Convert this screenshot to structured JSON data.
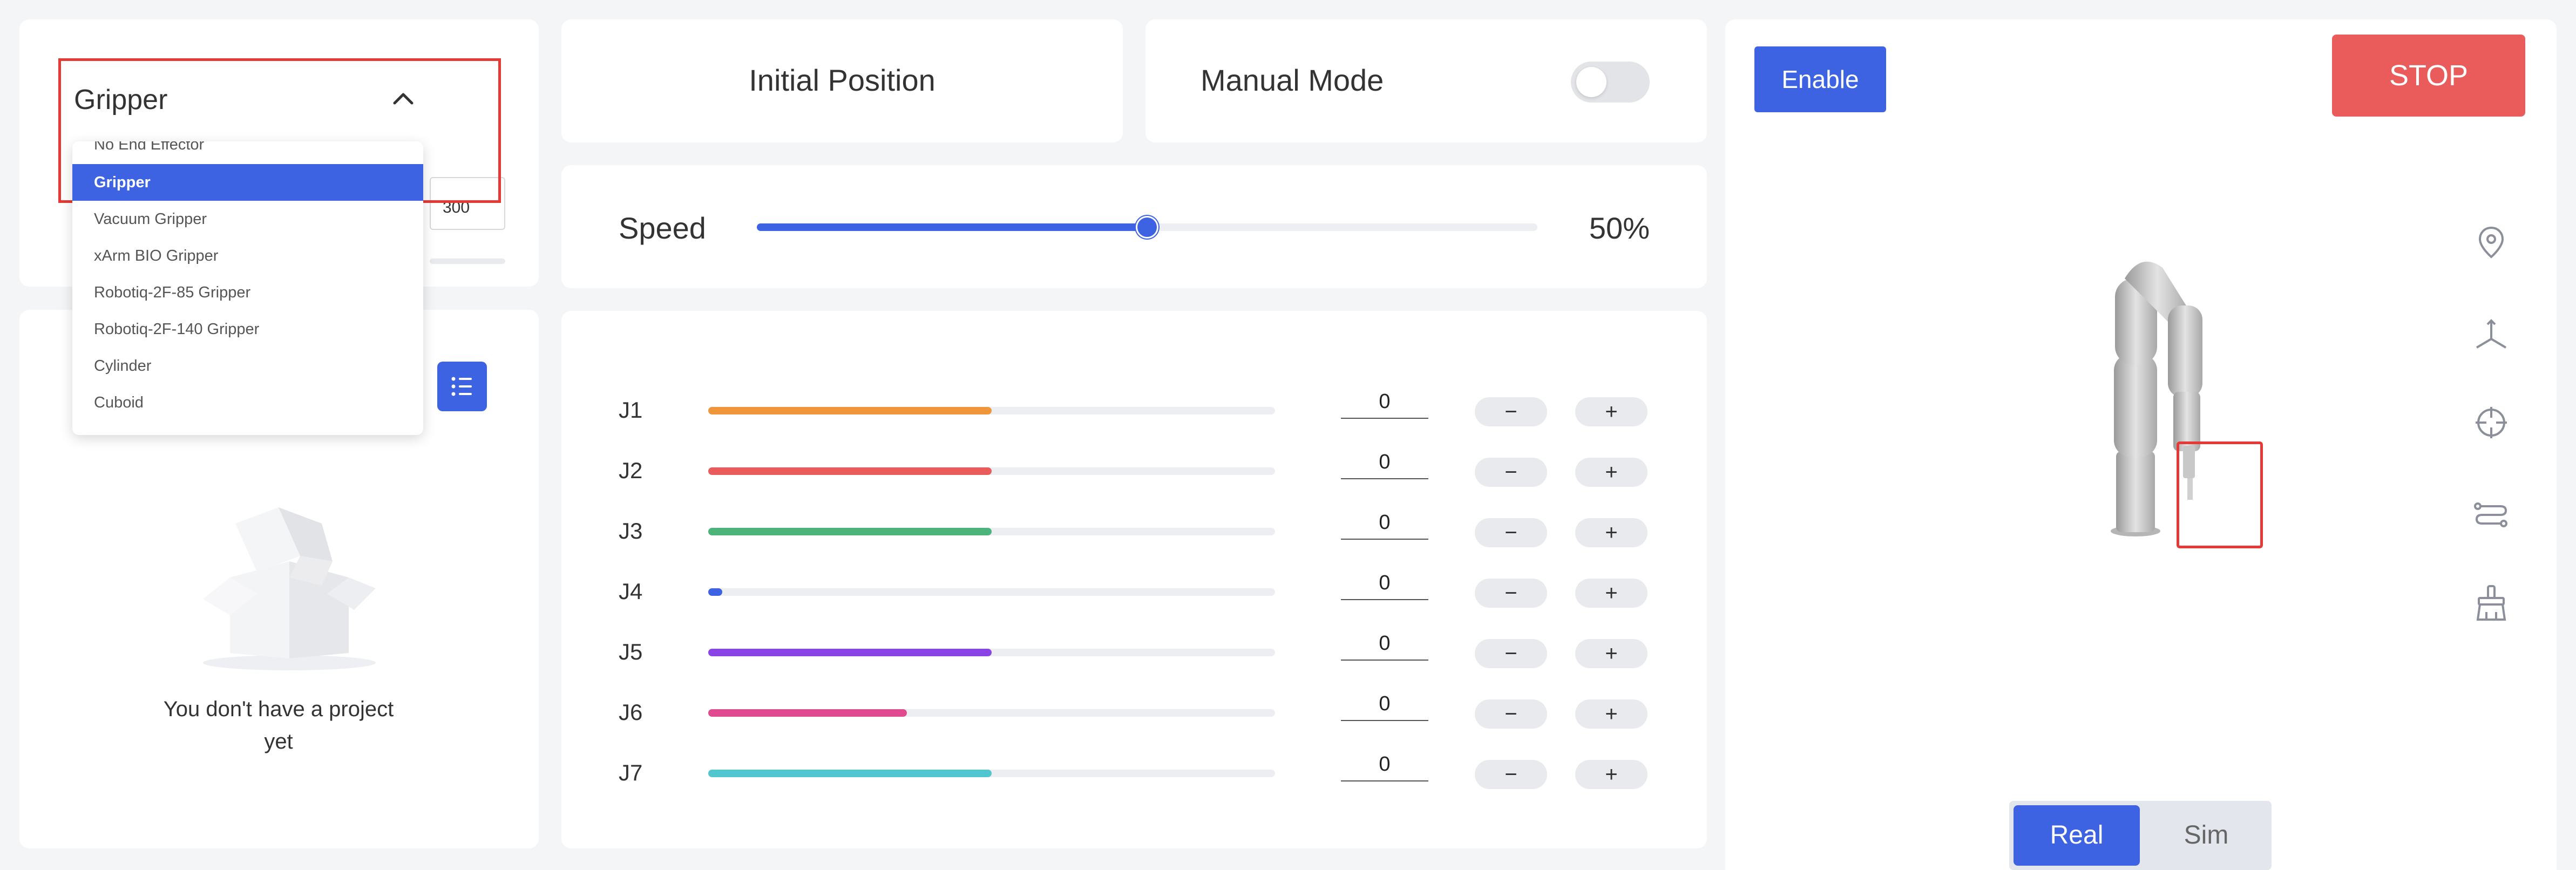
{
  "end_effector": {
    "selected_label": "Gripper",
    "value": "300",
    "options": [
      {
        "label": "No End Effector",
        "selected": false
      },
      {
        "label": "Gripper",
        "selected": true
      },
      {
        "label": "Vacuum Gripper",
        "selected": false
      },
      {
        "label": "xArm BIO Gripper",
        "selected": false
      },
      {
        "label": "Robotiq-2F-85 Gripper",
        "selected": false
      },
      {
        "label": "Robotiq-2F-140 Gripper",
        "selected": false
      },
      {
        "label": "Cylinder",
        "selected": false
      },
      {
        "label": "Cuboid",
        "selected": false
      }
    ]
  },
  "projects": {
    "empty_text": "You don't have a project yet",
    "list_icon": "list-icon"
  },
  "initial_position": {
    "label": "Initial Position"
  },
  "manual_mode": {
    "label": "Manual Mode",
    "enabled": false
  },
  "speed": {
    "label": "Speed",
    "percent": 50,
    "display": "50%"
  },
  "joints": [
    {
      "label": "J1",
      "value": "0",
      "fill": 0.5,
      "color": "#f0963a"
    },
    {
      "label": "J2",
      "value": "0",
      "fill": 0.5,
      "color": "#ea5c5c"
    },
    {
      "label": "J3",
      "value": "0",
      "fill": 0.5,
      "color": "#4cb37a"
    },
    {
      "label": "J4",
      "value": "0",
      "fill": 0.025,
      "color": "#3d63e3"
    },
    {
      "label": "J5",
      "value": "0",
      "fill": 0.5,
      "color": "#8a44e6"
    },
    {
      "label": "J6",
      "value": "0",
      "fill": 0.35,
      "color": "#df4b8e"
    },
    {
      "label": "J7",
      "value": "0",
      "fill": 0.5,
      "color": "#52c6cf"
    }
  ],
  "joint_controls": {
    "minus": "−",
    "plus": "+"
  },
  "robot": {
    "enable_label": "Enable",
    "stop_label": "STOP",
    "mode_real": "Real",
    "mode_sim": "Sim",
    "side_icons": [
      "location-pin-icon",
      "axes-icon",
      "crosshair-icon",
      "path-icon",
      "brush-icon"
    ]
  },
  "colors": {
    "accent": "#3d63e3",
    "stop": "#ea5c5c",
    "highlight": "#e53935"
  }
}
